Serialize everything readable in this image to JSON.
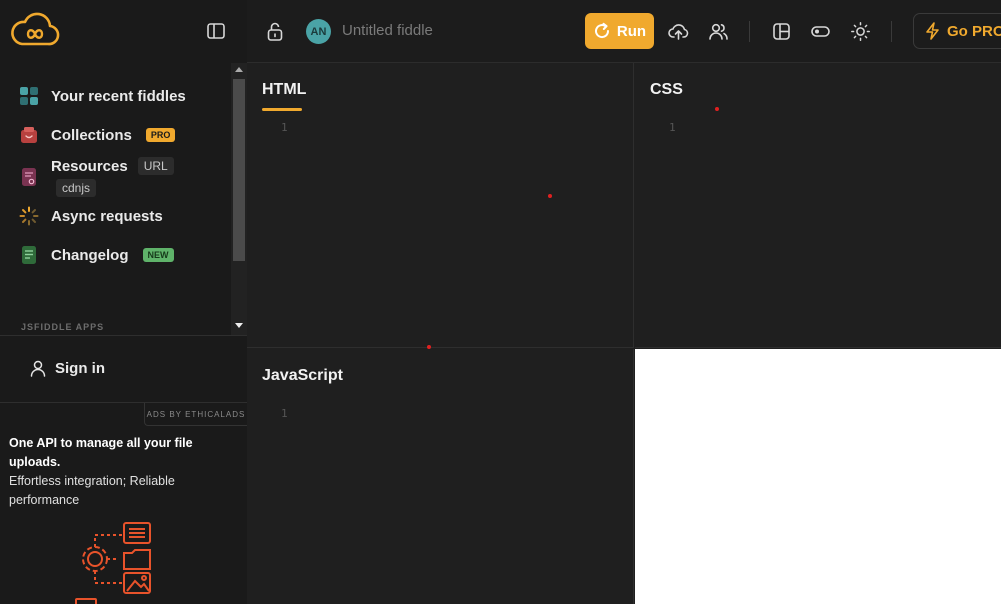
{
  "header": {
    "fiddle_title": "Untitled fiddle",
    "avatar_initials": "AN",
    "run_label": "Run",
    "gopro_label": "Go PRO"
  },
  "sidebar": {
    "items": [
      {
        "label": "Your recent fiddles",
        "icon": "grid-icon"
      },
      {
        "label": "Collections",
        "icon": "folder-icon",
        "badge": "PRO"
      },
      {
        "label": "Resources",
        "icon": "resources-icon",
        "tag": "URL",
        "subtag": "cdnjs"
      },
      {
        "label": "Async requests",
        "icon": "spinner-icon"
      },
      {
        "label": "Changelog",
        "icon": "document-icon",
        "badge": "NEW"
      }
    ],
    "section_label": "JSFIDDLE APPS",
    "signin_label": "Sign in"
  },
  "ad": {
    "tag": "ADS BY ETHICALADS",
    "title": "One API to manage all your file uploads.",
    "description": "Effortless integration; Reliable performance"
  },
  "editors": {
    "html": {
      "title": "HTML",
      "line": "1"
    },
    "css": {
      "title": "CSS",
      "line": "1"
    },
    "js": {
      "title": "JavaScript",
      "line": "1"
    }
  },
  "colors": {
    "accent": "#f0a92e",
    "background": "#1f1f1f",
    "sidebar": "#1a1a1a",
    "new_badge": "#5fb36a"
  }
}
